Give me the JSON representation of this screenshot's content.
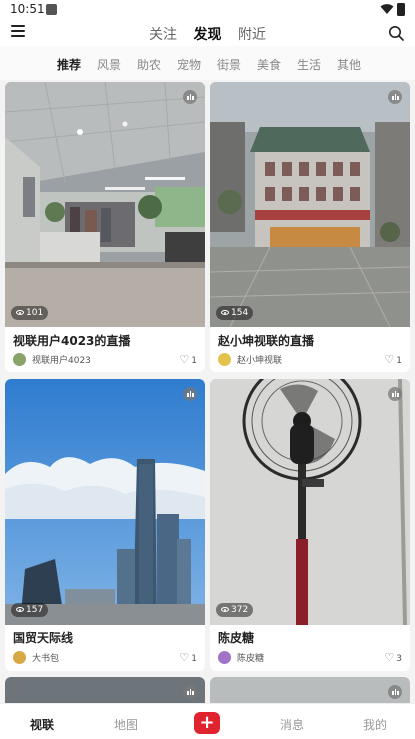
{
  "status": {
    "time": "10:51"
  },
  "top_tabs": [
    {
      "label": "关注"
    },
    {
      "label": "发现"
    },
    {
      "label": "附近"
    }
  ],
  "categories": [
    "推荐",
    "风景",
    "助农",
    "宠物",
    "街景",
    "美食",
    "生活",
    "其他"
  ],
  "cards": [
    {
      "title": "视联用户4023的直播",
      "author": "视联用户4023",
      "likes": "1",
      "views": "101"
    },
    {
      "title": "赵小坤视联的直播",
      "author": "赵小坤视联",
      "likes": "1",
      "views": "154"
    },
    {
      "title": "国贸天际线",
      "author": "大书包",
      "likes": "1",
      "views": "157"
    },
    {
      "title": "陈皮糖",
      "author": "陈皮糖",
      "likes": "3",
      "views": "372"
    }
  ],
  "bottom_nav": [
    {
      "label": "视联"
    },
    {
      "label": "地图"
    },
    {
      "label": "+"
    },
    {
      "label": "消息"
    },
    {
      "label": "我的"
    }
  ],
  "colors": {
    "accent": "#e0242f"
  }
}
